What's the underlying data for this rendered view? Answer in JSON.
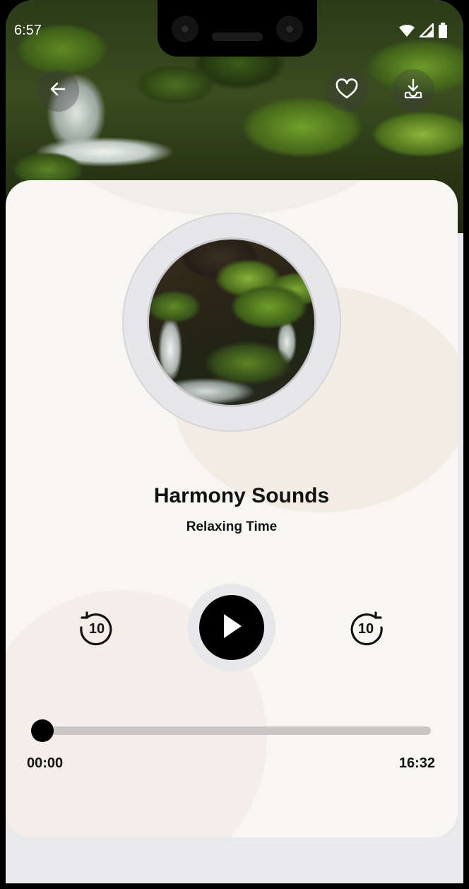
{
  "status_bar": {
    "time": "6:57",
    "icons": [
      "wifi-icon",
      "signal-icon",
      "battery-icon"
    ]
  },
  "top_actions": {
    "back_icon": "arrow-left-icon",
    "favorite_icon": "heart-icon",
    "download_icon": "download-icon"
  },
  "track": {
    "title": "Harmony Sounds",
    "subtitle": "Relaxing Time",
    "artwork": "moss-stream-photo"
  },
  "controls": {
    "rewind_label": "10",
    "forward_label": "10",
    "play_icon": "play-icon"
  },
  "progress": {
    "current": "00:00",
    "duration": "16:32",
    "fraction": 0
  },
  "colors": {
    "card_background": "#f8f6f2",
    "accent": "#000000",
    "track": "#c8c6c5"
  }
}
